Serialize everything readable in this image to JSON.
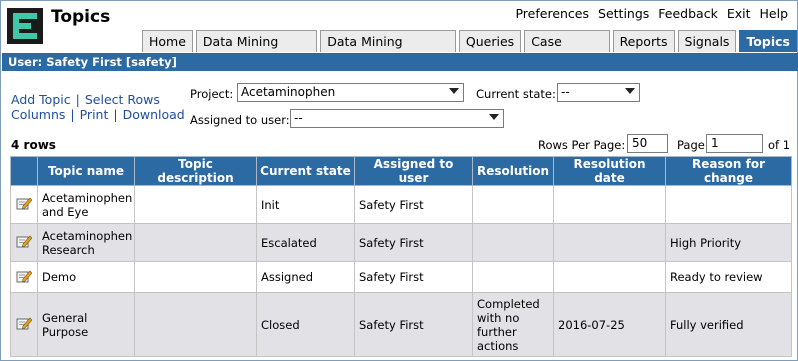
{
  "app": {
    "title": "Topics"
  },
  "top_links": [
    "Preferences",
    "Settings",
    "Feedback",
    "Exit",
    "Help"
  ],
  "tabs": [
    {
      "label": "Home",
      "active": false
    },
    {
      "label": "Data Mining Runs",
      "active": false
    },
    {
      "label": "Data Mining Results",
      "active": false
    },
    {
      "label": "Queries",
      "active": false
    },
    {
      "label": "Case Series",
      "active": false
    },
    {
      "label": "Reports",
      "active": false
    },
    {
      "label": "Signals",
      "active": false
    },
    {
      "label": "Topics",
      "active": true
    }
  ],
  "user_bar": "User: Safety First [safety]",
  "actions": {
    "add_topic": "Add Topic",
    "select_rows": "Select Rows",
    "columns": "Columns",
    "print": "Print",
    "download": "Download",
    "separator": "|"
  },
  "filters": {
    "project_label": "Project:",
    "project_value": "Acetaminophen",
    "state_label": "Current state:",
    "state_value": "--",
    "assigned_label": "Assigned to user:",
    "assigned_value": "--"
  },
  "paging": {
    "row_count": "4 rows",
    "rows_per_page_label": "Rows Per Page:",
    "rows_per_page_value": "50",
    "page_label": "Page",
    "page_value": "1",
    "of_label": "of 1"
  },
  "table": {
    "columns": [
      "Topic name",
      "Topic description",
      "Current state",
      "Assigned to user",
      "Resolution",
      "Resolution date",
      "Reason for change"
    ],
    "rows": [
      {
        "name": "Acetaminophen and Eye",
        "description": "",
        "state": "Init",
        "assigned": "Safety First",
        "resolution": "",
        "date": "",
        "reason": ""
      },
      {
        "name": "Acetaminophen Research",
        "description": "",
        "state": "Escalated",
        "assigned": "Safety First",
        "resolution": "",
        "date": "",
        "reason": "High Priority"
      },
      {
        "name": "Demo",
        "description": "",
        "state": "Assigned",
        "assigned": "Safety First",
        "resolution": "",
        "date": "",
        "reason": "Ready to review"
      },
      {
        "name": "General Purpose",
        "description": "",
        "state": "Closed",
        "assigned": "Safety First",
        "resolution": "Completed with no further actions",
        "date": "2016-07-25",
        "reason": "Fully verified"
      }
    ]
  },
  "colors": {
    "accent": "#2b6aa3",
    "link": "#1f4fa0",
    "row_alt": "#e2e2e6"
  },
  "icons": {
    "logo": "app-logo-icon",
    "row_edit": "edit-icon"
  }
}
